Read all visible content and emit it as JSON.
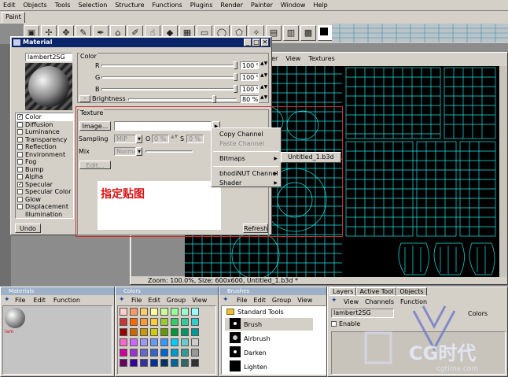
{
  "menubar": {
    "items": [
      "Edit",
      "Objects",
      "Tools",
      "Selection",
      "Structure",
      "Functions",
      "Plugins",
      "Render",
      "Painter",
      "Window",
      "Help"
    ]
  },
  "tabs": {
    "paint": "Paint"
  },
  "material": {
    "title": "Material",
    "name": "lambert2SG",
    "channels": [
      {
        "label": "Color",
        "checked": true
      },
      {
        "label": "Diffusion",
        "checked": false
      },
      {
        "label": "Luminance",
        "checked": false
      },
      {
        "label": "Transparency",
        "checked": false
      },
      {
        "label": "Reflection",
        "checked": false
      },
      {
        "label": "Environment",
        "checked": false
      },
      {
        "label": "Fog",
        "checked": false
      },
      {
        "label": "Bump",
        "checked": false
      },
      {
        "label": "Alpha",
        "checked": false
      },
      {
        "label": "Specular",
        "checked": true
      },
      {
        "label": "Specular Color",
        "checked": false
      },
      {
        "label": "Glow",
        "checked": false
      },
      {
        "label": "Displacement",
        "checked": false
      },
      {
        "label": "Illumination",
        "checked": false
      }
    ],
    "color_group": "Color",
    "r_label": "R",
    "r_value": "100 %",
    "g_label": "G",
    "g_value": "100 %",
    "b_label": "B",
    "b_value": "100 %",
    "brightness_label": "Brightness",
    "brightness_value": "80 %",
    "texture_group": "Texture",
    "image_button": "Image...",
    "sampling_label": "Sampling",
    "sampling_value": "MIP",
    "o_label": "O",
    "o_value": "0 %",
    "s_label": "S",
    "s_value": "0 %",
    "mix_label": "Mix",
    "mix_value": "Normal",
    "mix_pct": "100 %",
    "edit_button": "Edit...",
    "undo_button": "Undo",
    "refresh_button": "Refresh",
    "annotation": "指定贴图"
  },
  "context_menu": {
    "items": [
      "Copy Channel",
      "Paste Channel",
      "Bitmaps",
      "bhodiNUT Channel",
      "Shader"
    ],
    "submenu_item": "Untitled_1.b3d"
  },
  "viewport": {
    "menu": [
      "ter",
      "View",
      "Textures"
    ],
    "status": "Zoom: 100.0%, Size: 600x600, Untitled_1.b3d *"
  },
  "materials_panel": {
    "title": "Materials",
    "menu": [
      "File",
      "Edit",
      "Function"
    ]
  },
  "colors_panel": {
    "title": "Colors",
    "menu": [
      "File",
      "Edit",
      "Group",
      "View"
    ]
  },
  "brushes_panel": {
    "title": "Brushes",
    "menu": [
      "File",
      "Edit",
      "Group",
      "View"
    ],
    "group": "Standard Tools",
    "items": [
      "Brush",
      "Airbrush",
      "Darken",
      "Lighten"
    ]
  },
  "layers_panel": {
    "tabs": [
      "Layers",
      "Active Tool",
      "Objects"
    ],
    "menu": [
      "View",
      "Channels",
      "Function"
    ],
    "material": "lambert2SG",
    "label": "Colors",
    "enable": "Enable"
  },
  "watermark": {
    "logo": "CG时代",
    "url": "cgtime.com"
  },
  "colors": {
    "titlebar": "#0a246a",
    "annotation": "#d81010",
    "uv_lines": "#1fe6e6",
    "selection": "#cc3030"
  }
}
